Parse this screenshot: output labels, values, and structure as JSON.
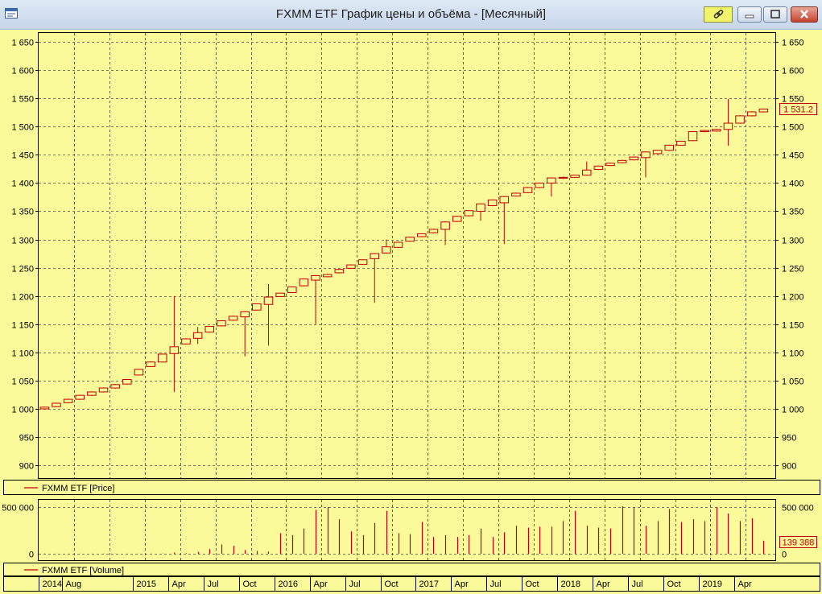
{
  "window": {
    "title": "FXMM ETF График цены и объёма - [Месячный]",
    "icons": [
      "app-window-icon",
      "link-icon",
      "minimize-icon",
      "maximize-icon",
      "close-icon"
    ]
  },
  "colors": {
    "background": "#fafa9b",
    "series": "#c00000",
    "grid": "#000000"
  },
  "chart_data": [
    {
      "type": "candlestick",
      "panel": "price",
      "legend": "FXMM ETF [Price]",
      "last_value_label": "1 531.2",
      "y_ticks": [
        "1 650",
        "1 600",
        "1 550",
        "1 500",
        "1 450",
        "1 400",
        "1 350",
        "1 300",
        "1 250",
        "1 200",
        "1 150",
        "1 100",
        "1 050",
        "1 000",
        "950",
        "900"
      ],
      "ylim": [
        880,
        1670
      ],
      "grid": true,
      "candles": [
        {
          "o": 1000,
          "c": 1003,
          "h": 1004,
          "l": 1000
        },
        {
          "o": 1004,
          "c": 1010,
          "h": 1011,
          "l": 1003
        },
        {
          "o": 1011,
          "c": 1017,
          "h": 1018,
          "l": 1010
        },
        {
          "o": 1017,
          "c": 1024,
          "h": 1025,
          "l": 1016
        },
        {
          "o": 1024,
          "c": 1030,
          "h": 1031,
          "l": 1023
        },
        {
          "o": 1030,
          "c": 1037,
          "h": 1038,
          "l": 1029
        },
        {
          "o": 1037,
          "c": 1043,
          "h": 1044,
          "l": 1036
        },
        {
          "o": 1044,
          "c": 1052,
          "h": 1053,
          "l": 1043
        },
        {
          "o": 1060,
          "c": 1070,
          "h": 1071,
          "l": 1059
        },
        {
          "o": 1075,
          "c": 1083,
          "h": 1084,
          "l": 1074
        },
        {
          "o": 1083,
          "c": 1097,
          "h": 1098,
          "l": 1082
        },
        {
          "o": 1098,
          "c": 1110,
          "h": 1200,
          "l": 1030
        },
        {
          "o": 1115,
          "c": 1124,
          "h": 1125,
          "l": 1114
        },
        {
          "o": 1125,
          "c": 1135,
          "h": 1145,
          "l": 1115
        },
        {
          "o": 1136,
          "c": 1146,
          "h": 1147,
          "l": 1135
        },
        {
          "o": 1147,
          "c": 1156,
          "h": 1157,
          "l": 1146
        },
        {
          "o": 1157,
          "c": 1164,
          "h": 1165,
          "l": 1156
        },
        {
          "o": 1163,
          "c": 1172,
          "h": 1173,
          "l": 1093
        },
        {
          "o": 1175,
          "c": 1186,
          "h": 1187,
          "l": 1174
        },
        {
          "o": 1185,
          "c": 1198,
          "h": 1221,
          "l": 1112
        },
        {
          "o": 1199,
          "c": 1205,
          "h": 1206,
          "l": 1198
        },
        {
          "o": 1206,
          "c": 1216,
          "h": 1217,
          "l": 1205
        },
        {
          "o": 1218,
          "c": 1230,
          "h": 1231,
          "l": 1217
        },
        {
          "o": 1228,
          "c": 1236,
          "h": 1237,
          "l": 1150
        },
        {
          "o": 1234,
          "c": 1238,
          "h": 1239,
          "l": 1233
        },
        {
          "o": 1241,
          "c": 1247,
          "h": 1248,
          "l": 1240
        },
        {
          "o": 1249,
          "c": 1255,
          "h": 1256,
          "l": 1248
        },
        {
          "o": 1256,
          "c": 1264,
          "h": 1265,
          "l": 1255
        },
        {
          "o": 1266,
          "c": 1275,
          "h": 1276,
          "l": 1188
        },
        {
          "o": 1276,
          "c": 1287,
          "h": 1300,
          "l": 1275
        },
        {
          "o": 1286,
          "c": 1295,
          "h": 1296,
          "l": 1285
        },
        {
          "o": 1297,
          "c": 1304,
          "h": 1305,
          "l": 1296
        },
        {
          "o": 1305,
          "c": 1310,
          "h": 1311,
          "l": 1304
        },
        {
          "o": 1312,
          "c": 1318,
          "h": 1319,
          "l": 1311
        },
        {
          "o": 1318,
          "c": 1331,
          "h": 1332,
          "l": 1290
        },
        {
          "o": 1332,
          "c": 1341,
          "h": 1342,
          "l": 1331
        },
        {
          "o": 1342,
          "c": 1351,
          "h": 1352,
          "l": 1341
        },
        {
          "o": 1350,
          "c": 1363,
          "h": 1364,
          "l": 1333
        },
        {
          "o": 1360,
          "c": 1370,
          "h": 1371,
          "l": 1359
        },
        {
          "o": 1365,
          "c": 1376,
          "h": 1377,
          "l": 1292
        },
        {
          "o": 1377,
          "c": 1382,
          "h": 1383,
          "l": 1376
        },
        {
          "o": 1383,
          "c": 1392,
          "h": 1393,
          "l": 1382
        },
        {
          "o": 1392,
          "c": 1400,
          "h": 1401,
          "l": 1391
        },
        {
          "o": 1400,
          "c": 1409,
          "h": 1410,
          "l": 1376
        },
        {
          "o": 1409,
          "c": 1410,
          "h": 1411,
          "l": 1407
        },
        {
          "o": 1410,
          "c": 1414,
          "h": 1415,
          "l": 1409
        },
        {
          "o": 1414,
          "c": 1423,
          "h": 1438,
          "l": 1413
        },
        {
          "o": 1424,
          "c": 1430,
          "h": 1431,
          "l": 1423
        },
        {
          "o": 1431,
          "c": 1435,
          "h": 1436,
          "l": 1430
        },
        {
          "o": 1436,
          "c": 1440,
          "h": 1441,
          "l": 1435
        },
        {
          "o": 1441,
          "c": 1446,
          "h": 1447,
          "l": 1440
        },
        {
          "o": 1445,
          "c": 1455,
          "h": 1456,
          "l": 1410
        },
        {
          "o": 1452,
          "c": 1458,
          "h": 1459,
          "l": 1451
        },
        {
          "o": 1458,
          "c": 1467,
          "h": 1468,
          "l": 1457
        },
        {
          "o": 1467,
          "c": 1474,
          "h": 1475,
          "l": 1466
        },
        {
          "o": 1475,
          "c": 1491,
          "h": 1492,
          "l": 1474
        },
        {
          "o": 1491,
          "c": 1493,
          "h": 1494,
          "l": 1490
        },
        {
          "o": 1492,
          "c": 1495,
          "h": 1496,
          "l": 1491
        },
        {
          "o": 1495,
          "c": 1506,
          "h": 1549,
          "l": 1466
        },
        {
          "o": 1506,
          "c": 1519,
          "h": 1520,
          "l": 1505
        },
        {
          "o": 1519,
          "c": 1526,
          "h": 1527,
          "l": 1518
        },
        {
          "o": 1526,
          "c": 1531,
          "h": 1532,
          "l": 1525
        }
      ]
    },
    {
      "type": "bar",
      "panel": "volume",
      "legend": "FXMM ETF [Volume]",
      "last_value_label": "139 388",
      "y_ticks": [
        "500 000",
        "0"
      ],
      "ylim": [
        0,
        500000
      ],
      "grid": true,
      "values": [
        2000,
        1000,
        1000,
        1500,
        1000,
        2000,
        1500,
        1000,
        1000,
        1500,
        3000,
        12000,
        6000,
        20000,
        50000,
        100000,
        85000,
        40000,
        30000,
        25000,
        220000,
        200000,
        270000,
        470000,
        500000,
        370000,
        240000,
        200000,
        330000,
        460000,
        220000,
        210000,
        340000,
        180000,
        200000,
        180000,
        200000,
        270000,
        180000,
        230000,
        300000,
        280000,
        290000,
        290000,
        350000,
        460000,
        300000,
        280000,
        270000,
        510000,
        500000,
        300000,
        350000,
        480000,
        340000,
        370000,
        350000,
        500000,
        430000,
        350000,
        380000,
        139388
      ]
    }
  ],
  "x_axis": {
    "labels": [
      "2014",
      "Aug",
      "2015",
      "Apr",
      "Jul",
      "Oct",
      "2016",
      "Apr",
      "Jul",
      "Oct",
      "2017",
      "Apr",
      "Jul",
      "Oct",
      "2018",
      "Apr",
      "Jul",
      "Oct",
      "2019",
      "Apr"
    ],
    "label_month_index": [
      0,
      2,
      8,
      11,
      14,
      17,
      20,
      23,
      26,
      29,
      32,
      35,
      38,
      41,
      44,
      47,
      50,
      53,
      56,
      59
    ]
  }
}
